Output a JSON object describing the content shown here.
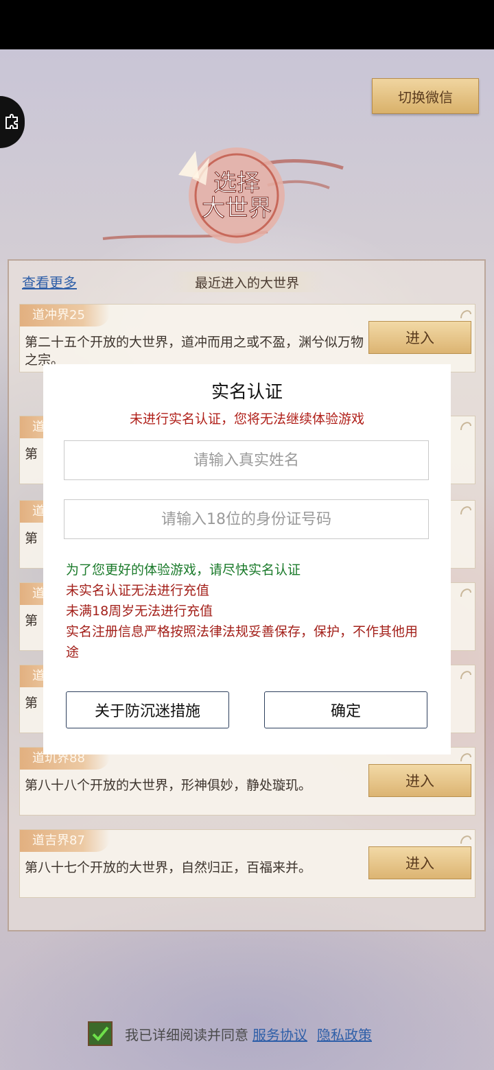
{
  "header": {
    "switch_label": "切换微信"
  },
  "logo": {
    "line1": "选择",
    "line2": "大世界"
  },
  "panel": {
    "more_link": "查看更多",
    "recent_title": "最近进入的大世界"
  },
  "cards": [
    {
      "tag": "道冲界25",
      "desc": "第二十五个开放的大世界，道冲而用之或不盈，渊兮似万物之宗。",
      "button": "进入"
    },
    {
      "tag": "道",
      "desc": "第",
      "button": ""
    },
    {
      "tag": "道",
      "desc": "第",
      "button": ""
    },
    {
      "tag": "道",
      "desc": "第",
      "button": ""
    },
    {
      "tag": "道",
      "desc": "第",
      "button": ""
    },
    {
      "tag": "道玑界88",
      "desc": "第八十八个开放的大世界，形神俱妙，静处璇玑。",
      "button": "进入"
    },
    {
      "tag": "道吉界87",
      "desc": "第八十七个开放的大世界，自然归正，百福来并。",
      "button": "进入"
    }
  ],
  "dialog": {
    "title": "实名认证",
    "warning": "未进行实名认证，您将无法继续体验游戏",
    "name_placeholder": "请输入真实姓名",
    "id_placeholder": "请输入18位的身份证号码",
    "note_green": "为了您更好的体验游戏，请尽快实名认证",
    "note_red_1": "未实名认证无法进行充值",
    "note_red_2": "未满18周岁无法进行充值",
    "note_red_3": "实名注册信息严格按照法律法规妥善保存，保护，不作其他用途",
    "anti_addiction_button": "关于防沉迷措施",
    "confirm_button": "确定"
  },
  "footer": {
    "agree_text": "我已详细阅读并同意",
    "service_link": "服务协议",
    "privacy_link": "隐私政策"
  },
  "colors": {
    "link": "#2f5fa8",
    "warning": "#b0201a",
    "note_green": "#1a7a2a",
    "gold_button": "#dcb472"
  }
}
